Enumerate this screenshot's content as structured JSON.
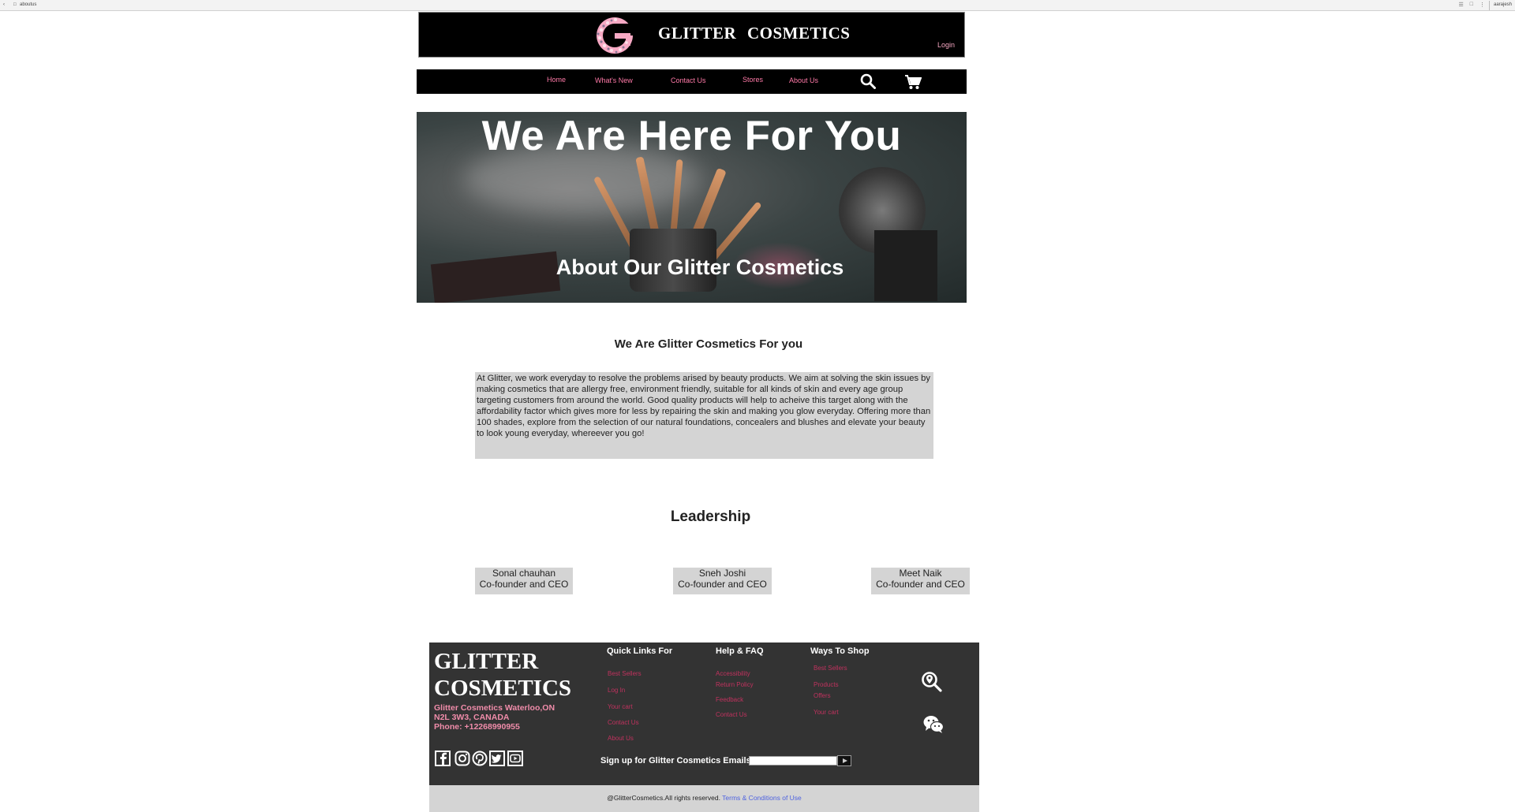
{
  "browser": {
    "tab_url": "aboutus",
    "user_label": "aarajesh"
  },
  "header": {
    "brand": "GLITTER  COSMETICS",
    "logo_letter": "G",
    "login": "Login"
  },
  "nav": {
    "items": [
      {
        "label": "Home"
      },
      {
        "label": "What's New"
      },
      {
        "label": "Contact Us"
      },
      {
        "label": "Stores"
      },
      {
        "label": "About Us"
      }
    ]
  },
  "hero": {
    "title": "We Are Here For You",
    "subtitle": "About Our Glitter Cosmetics"
  },
  "about": {
    "title": "We Are Glitter Cosmetics For you",
    "body": "At Glitter, we work everyday to resolve the problems arised by beauty products. We aim at solving the skin issues by making cosmetics that are allergy free, environment friendly, suitable for all kinds of skin and every age group targeting customers from around the world.  Good quality products will help to acheive this target along with the affordability factor which gives more for less by repairing the skin and making you glow everyday. Offering more than 100 shades, explore from the selection of our natural foundations, concealers and blushes and elevate your beauty to look young everyday, whereever you go!"
  },
  "leadership": {
    "title": "Leadership",
    "people": [
      {
        "name": "Sonal chauhan",
        "role": "Co-founder and CEO"
      },
      {
        "name": "Sneh Joshi",
        "role": "Co-founder and CEO"
      },
      {
        "name": "Meet Naik",
        "role": "Co-founder and CEO"
      }
    ]
  },
  "footer": {
    "brand_line1": "GLITTER",
    "brand_line2": "COSMETICS",
    "address_line1": "Glitter Cosmetics Waterloo,ON",
    "address_line2": "N2L 3W3, CANADA",
    "phone": "Phone: +12268990955",
    "quick_links": {
      "title": "Quick Links For",
      "items": [
        "Best Sellers",
        "Log In",
        "Your cart",
        "Contact Us",
        "About Us"
      ]
    },
    "help": {
      "title": "Help & FAQ",
      "items": [
        "Accessibility",
        "Return Policy",
        "Feedback",
        "Contact Us"
      ]
    },
    "ways": {
      "title": "Ways To Shop",
      "items": [
        "Best Sellers",
        "Products",
        "Offers",
        "Your cart"
      ]
    },
    "signup_label": "Sign up for Glitter Cosmetics Emails",
    "signup_value": "",
    "social_icons": [
      "facebook-icon",
      "instagram-icon",
      "pinterest-icon",
      "twitter-icon",
      "youtube-icon"
    ]
  },
  "copyright": {
    "text": "@GlitterCosmetics.All rights reserved. ",
    "terms": "Terms & Conditions of Use"
  },
  "colors": {
    "accent_pink": "#ff7aa8",
    "footer_bg": "#333333",
    "panel_grey": "#d4d4d4"
  }
}
